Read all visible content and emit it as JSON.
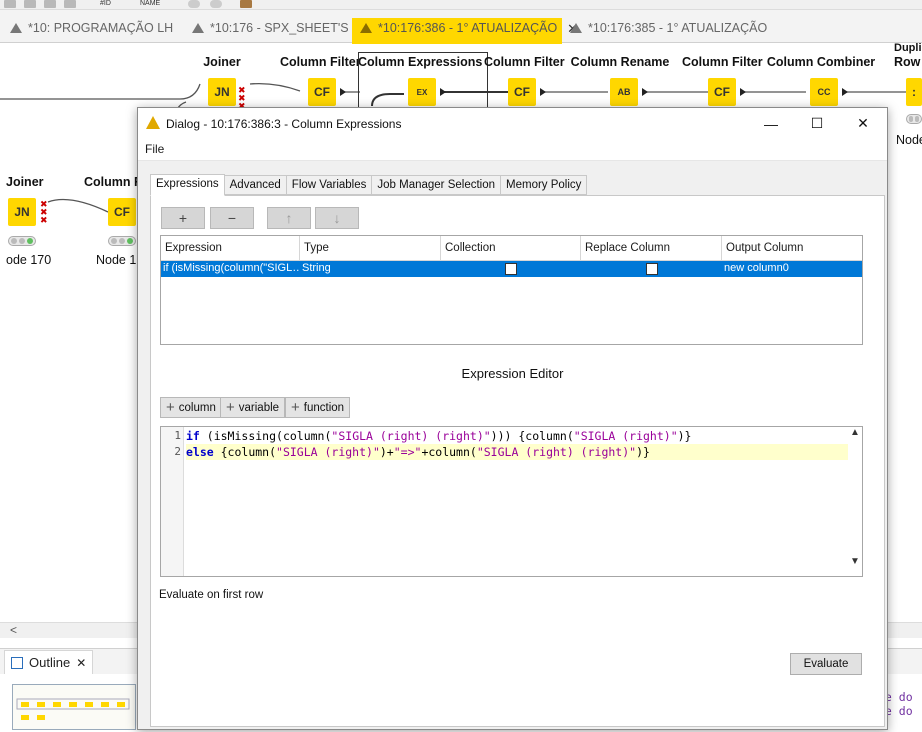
{
  "editor_tabs": [
    {
      "label": "*10: PROGRAMAÇÃO LH",
      "active": false
    },
    {
      "label": "*10:176 - SPX_SHEET'S",
      "active": false
    },
    {
      "label": "*10:176:386 - 1° ATUALIZAÇÃO",
      "active": true
    },
    {
      "label": "*10:176:385 - 1° ATUALIZAÇÃO",
      "active": false
    }
  ],
  "toolbar": {
    "id_icon_text": "#ID",
    "name_icon_text": "NAME"
  },
  "canvas": {
    "nodes_top": [
      {
        "label": "Joiner",
        "icon": "JN"
      },
      {
        "label": "Column Filter",
        "icon": "CF"
      },
      {
        "label": "Column Expressions",
        "icon": "EX"
      },
      {
        "label": "Column Filter",
        "icon": "CF"
      },
      {
        "label": "Column Rename",
        "icon": "AB"
      },
      {
        "label": "Column Filter",
        "icon": "CF"
      },
      {
        "label": "Column Combiner",
        "icon": "CC"
      },
      {
        "label": "Dupli",
        "label2": "Row I",
        "icon": ":"
      }
    ],
    "nodes_left": [
      {
        "label": "Joiner",
        "sub": "ode 170"
      },
      {
        "label": "Column F",
        "sub": "Node 1"
      }
    ],
    "right_edge_sub": "Node",
    "scroll_left_arrow": "<"
  },
  "outline": {
    "tab_label": "Outline",
    "code_lines": [
      "le do",
      "le do"
    ]
  },
  "dialog": {
    "title": "Dialog - 10:176:386:3 - Column Expressions",
    "window_buttons": {
      "minimize": "—",
      "maximize": "☐",
      "close": "✕"
    },
    "menu": {
      "file": "File"
    },
    "tabs": [
      "Expressions",
      "Advanced",
      "Flow Variables",
      "Job Manager Selection",
      "Memory Policy"
    ],
    "toolbar_buttons": {
      "add": "+",
      "remove": "−",
      "up": "↑",
      "down": "↓"
    },
    "table": {
      "headers": [
        "Expression",
        "Type",
        "Collection",
        "Replace Column",
        "Output Column"
      ],
      "rows": [
        {
          "expression": "if (isMissing(column(\"SIGL…",
          "type": "String",
          "collection": false,
          "replace_column": false,
          "output_column": "new column0"
        }
      ]
    },
    "expression_editor_title": "Expression Editor",
    "insert_buttons": {
      "column": "column",
      "variable": "variable",
      "function": "function"
    },
    "code": {
      "line_numbers": [
        "1",
        "2"
      ],
      "line1": {
        "kw_if": "if",
        "t1": " (isMissing(column(",
        "s1": "\"SIGLA (right) (right)\"",
        "t2": "))) {column(",
        "s2": "\"SIGLA (right)\"",
        "t3": ")}"
      },
      "line2": {
        "kw_else": "else",
        "t1": " {column(",
        "s1": "\"SIGLA (right)\"",
        "t2": ")+",
        "s2": "\"=>\"",
        "t3": "+column(",
        "s3": "\"SIGLA (right) (right)\"",
        "t4": ")}"
      }
    },
    "evaluate_label": "Evaluate on first row",
    "evaluate_button": "Evaluate"
  },
  "colors": {
    "accent": "#ffd700",
    "selection": "#0078d7",
    "current_line": "#ffffcc"
  }
}
